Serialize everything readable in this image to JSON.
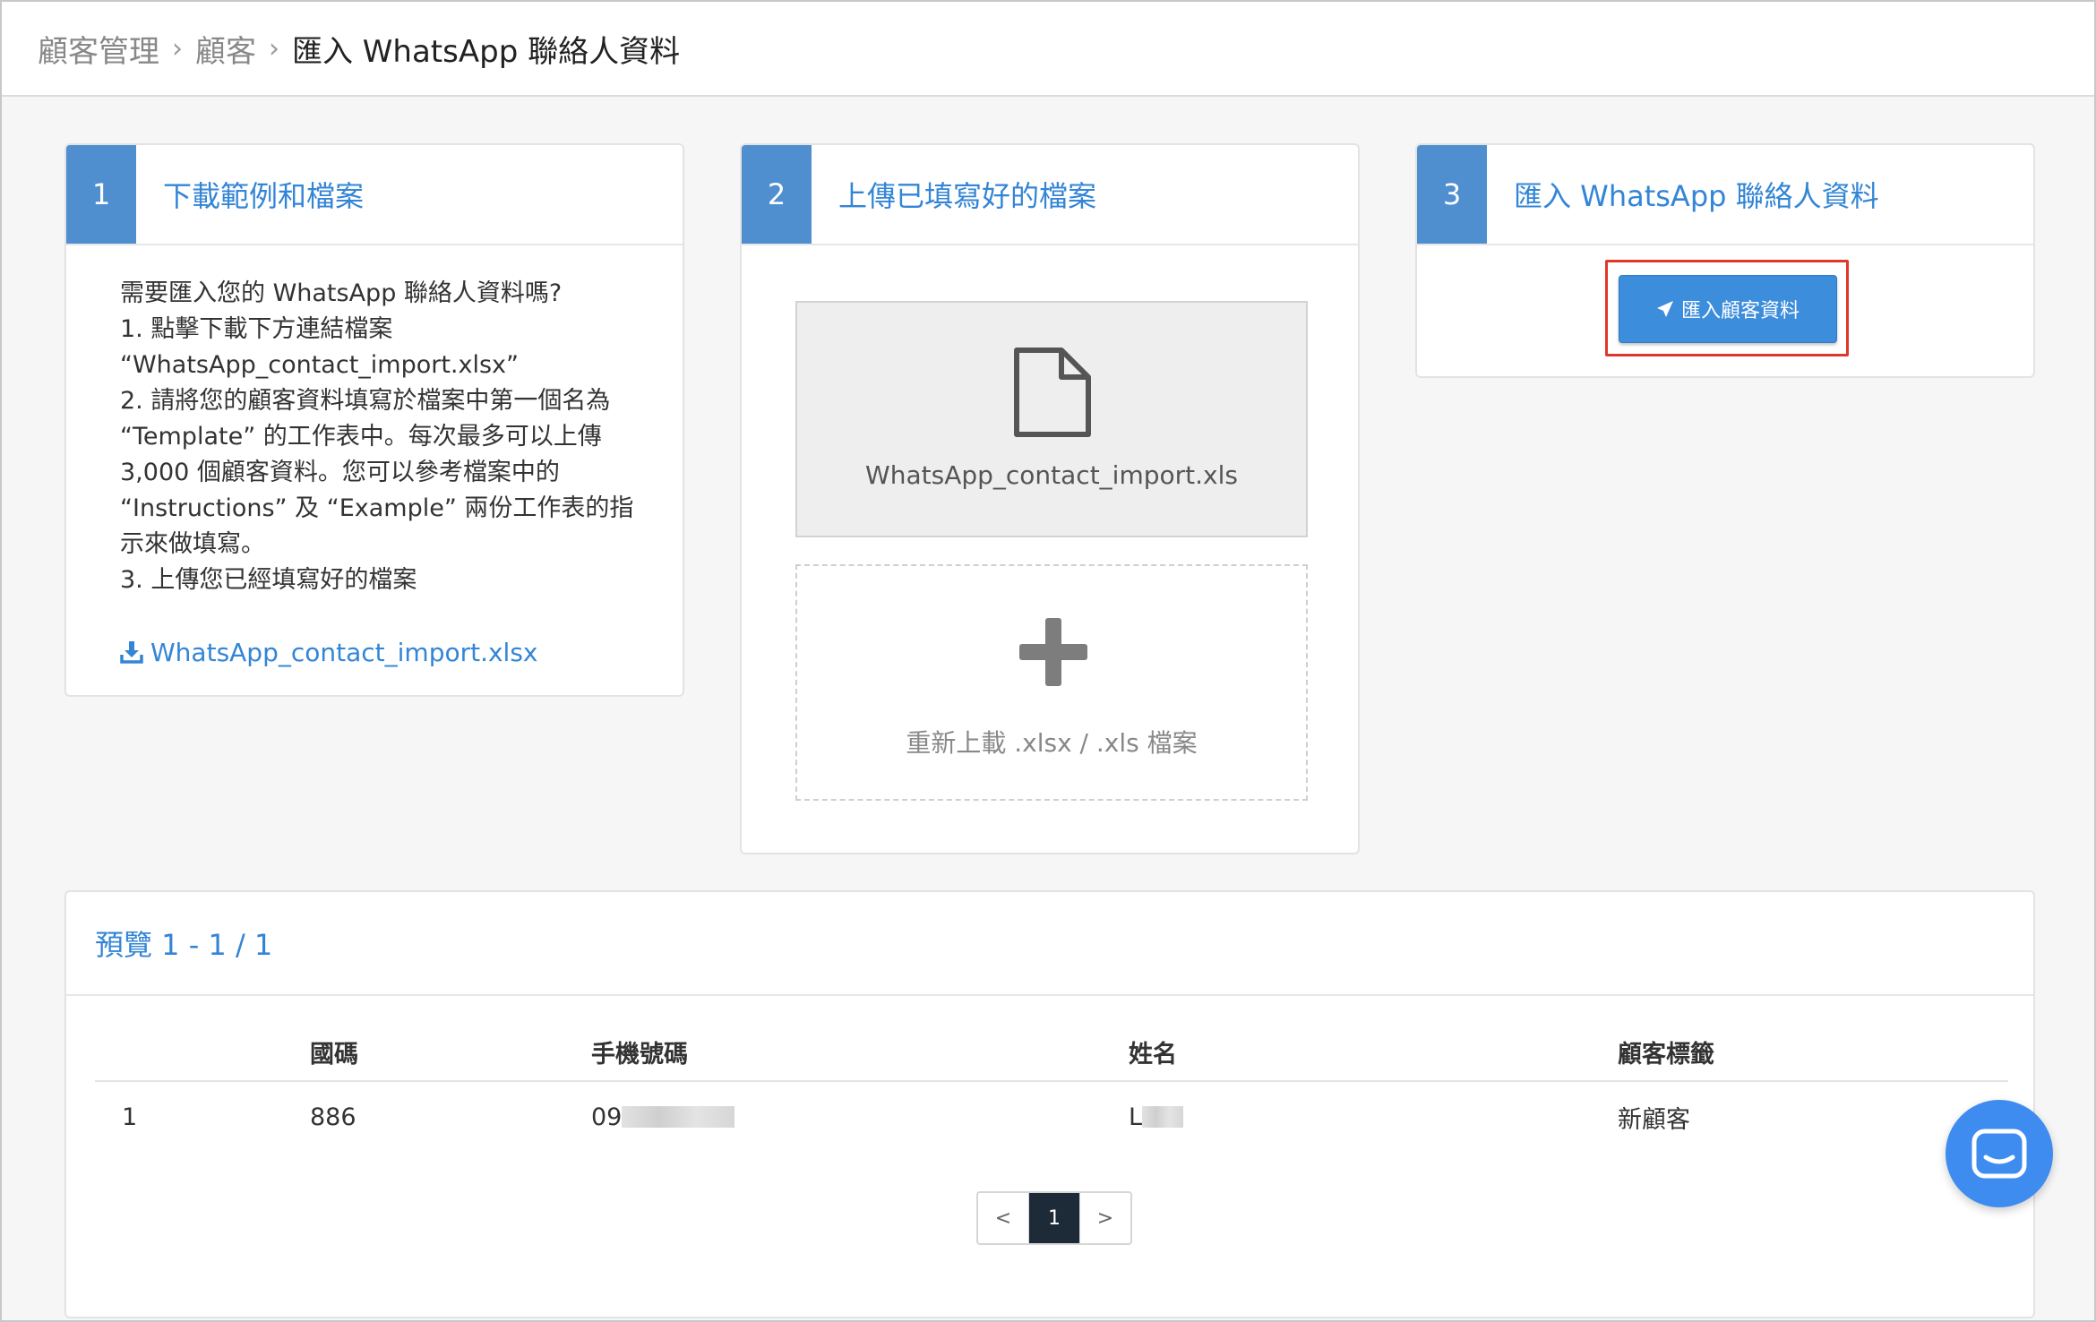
{
  "breadcrumb": {
    "items": [
      "顧客管理",
      "顧客",
      "匯入 WhatsApp 聯絡人資料"
    ]
  },
  "steps": [
    {
      "number": "1",
      "title": "下載範例和檔案",
      "instructions": [
        "需要匯入您的 WhatsApp 聯絡人資料嗎?",
        "1. 點擊下載下方連結檔案",
        "“WhatsApp_contact_import.xlsx”",
        "2. 請將您的顧客資料填寫於檔案中第一個名為",
        "“Template” 的工作表中。每次最多可以上傳",
        "3,000 個顧客資料。您可以參考檔案中的",
        "“Instructions” 及 “Example” 兩份工作表的指",
        "示來做填寫。",
        "3. 上傳您已經填寫好的檔案"
      ],
      "download_link": "WhatsApp_contact_import.xlsx",
      "download_icon": "download-icon"
    },
    {
      "number": "2",
      "title": "上傳已填寫好的檔案",
      "uploaded_file": "WhatsApp_contact_import.xls",
      "file_icon": "file-icon",
      "reupload_label": "重新上載 .xlsx / .xls 檔案",
      "reupload_icon": "plus-icon"
    },
    {
      "number": "3",
      "title": "匯入 WhatsApp 聯絡人資料",
      "import_button": "匯入顧客資料",
      "import_icon": "rocket-icon"
    }
  ],
  "preview": {
    "title": "預覽 1 - 1 / 1",
    "columns": [
      "",
      "國碼",
      "手機號碼",
      "姓名",
      "顧客標籤"
    ],
    "rows": [
      {
        "index": "1",
        "country_code": "886",
        "phone": "09",
        "name": "L",
        "tag": "新顧客"
      }
    ],
    "pagination": {
      "prev": "<",
      "current": "1",
      "next": ">"
    }
  },
  "chat_widget_icon": "chat-icon",
  "colors": {
    "accent": "#3385d6",
    "step_badge": "#4f8fd0",
    "button": "#3c8ddc",
    "highlight": "#e0372a",
    "chat": "#3f8cf0"
  }
}
